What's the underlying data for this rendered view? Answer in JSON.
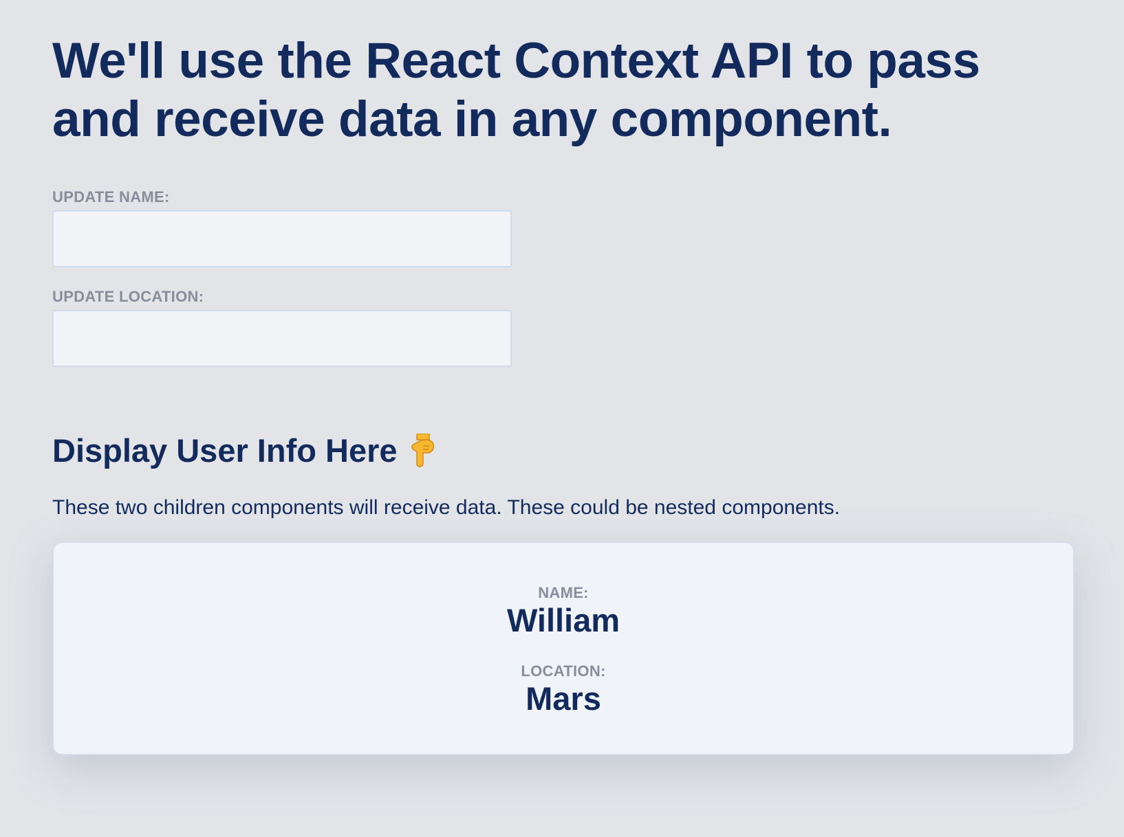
{
  "heading": "We'll use the React Context API to pass and receive data in any component.",
  "form": {
    "name_label": "UPDATE NAME:",
    "name_value": "",
    "location_label": "UPDATE LOCATION:",
    "location_value": ""
  },
  "display": {
    "title": "Display User Info Here",
    "title_icon": "pointing-down-hand-icon",
    "description": "These two children components will receive data. These could be nested components."
  },
  "user_info": {
    "name_label": "NAME:",
    "name": "William",
    "location_label": "LOCATION:",
    "location": "Mars"
  },
  "colors": {
    "background": "#e2e4e8",
    "heading": "#132a5c",
    "label": "#868d9b",
    "input_bg": "#f2f4f7",
    "input_border": "#cfdcef",
    "card_bg": "#f0f3f8",
    "emoji": "#f7b731"
  }
}
